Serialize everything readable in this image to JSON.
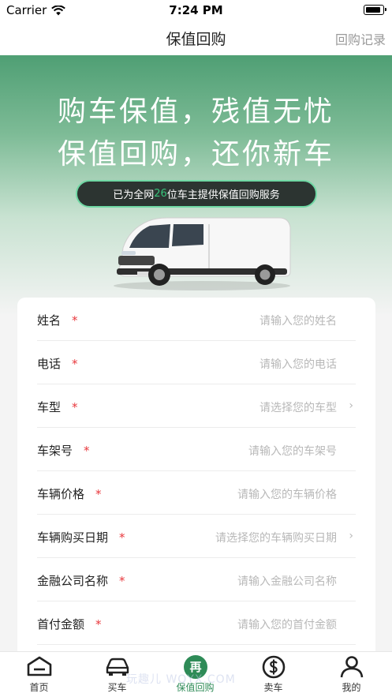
{
  "status_bar": {
    "carrier": "Carrier",
    "time": "7:24 PM"
  },
  "nav": {
    "title": "保值回购",
    "right_link": "回购记录"
  },
  "hero": {
    "slogan_line1": "购车保值，残值无忧",
    "slogan_line2": "保值回购，还你新车",
    "banner_prefix": "已为全网",
    "banner_count": "26",
    "banner_suffix": "位车主提供保值回购服务"
  },
  "form": {
    "fields": [
      {
        "label": "姓名",
        "required_mark": "*",
        "placeholder": "请输入您的姓名",
        "chevron": ""
      },
      {
        "label": "电话",
        "required_mark": "*",
        "placeholder": "请输入您的电话",
        "chevron": ""
      },
      {
        "label": "车型",
        "required_mark": "*",
        "placeholder": "请选择您的车型",
        "chevron": "›"
      },
      {
        "label": "车架号",
        "required_mark": "*",
        "placeholder": "请输入您的车架号",
        "chevron": ""
      },
      {
        "label": "车辆价格",
        "required_mark": "*",
        "placeholder": "请输入您的车辆价格",
        "chevron": ""
      },
      {
        "label": "车辆购买日期",
        "required_mark": "*",
        "placeholder": "请选择您的车辆购买日期",
        "chevron": "›"
      },
      {
        "label": "金融公司名称",
        "required_mark": "*",
        "placeholder": "请输入金融公司名称",
        "chevron": ""
      },
      {
        "label": "首付金额",
        "required_mark": "*",
        "placeholder": "请输入您的首付金额",
        "chevron": ""
      }
    ]
  },
  "tabbar": {
    "tabs": [
      {
        "label": "首页",
        "icon": "home-icon"
      },
      {
        "label": "买车",
        "icon": "car-icon"
      },
      {
        "label": "保值回购",
        "icon": "buyback-badge-icon",
        "badge_text": "再"
      },
      {
        "label": "卖车",
        "icon": "dollar-coin-icon"
      },
      {
        "label": "我的",
        "icon": "user-icon"
      }
    ]
  },
  "watermark": "玩趣儿 WQYX.COM",
  "colors": {
    "accent": "#2e8b57",
    "required": "#e8383d",
    "hero_top": "#4f9f74"
  }
}
